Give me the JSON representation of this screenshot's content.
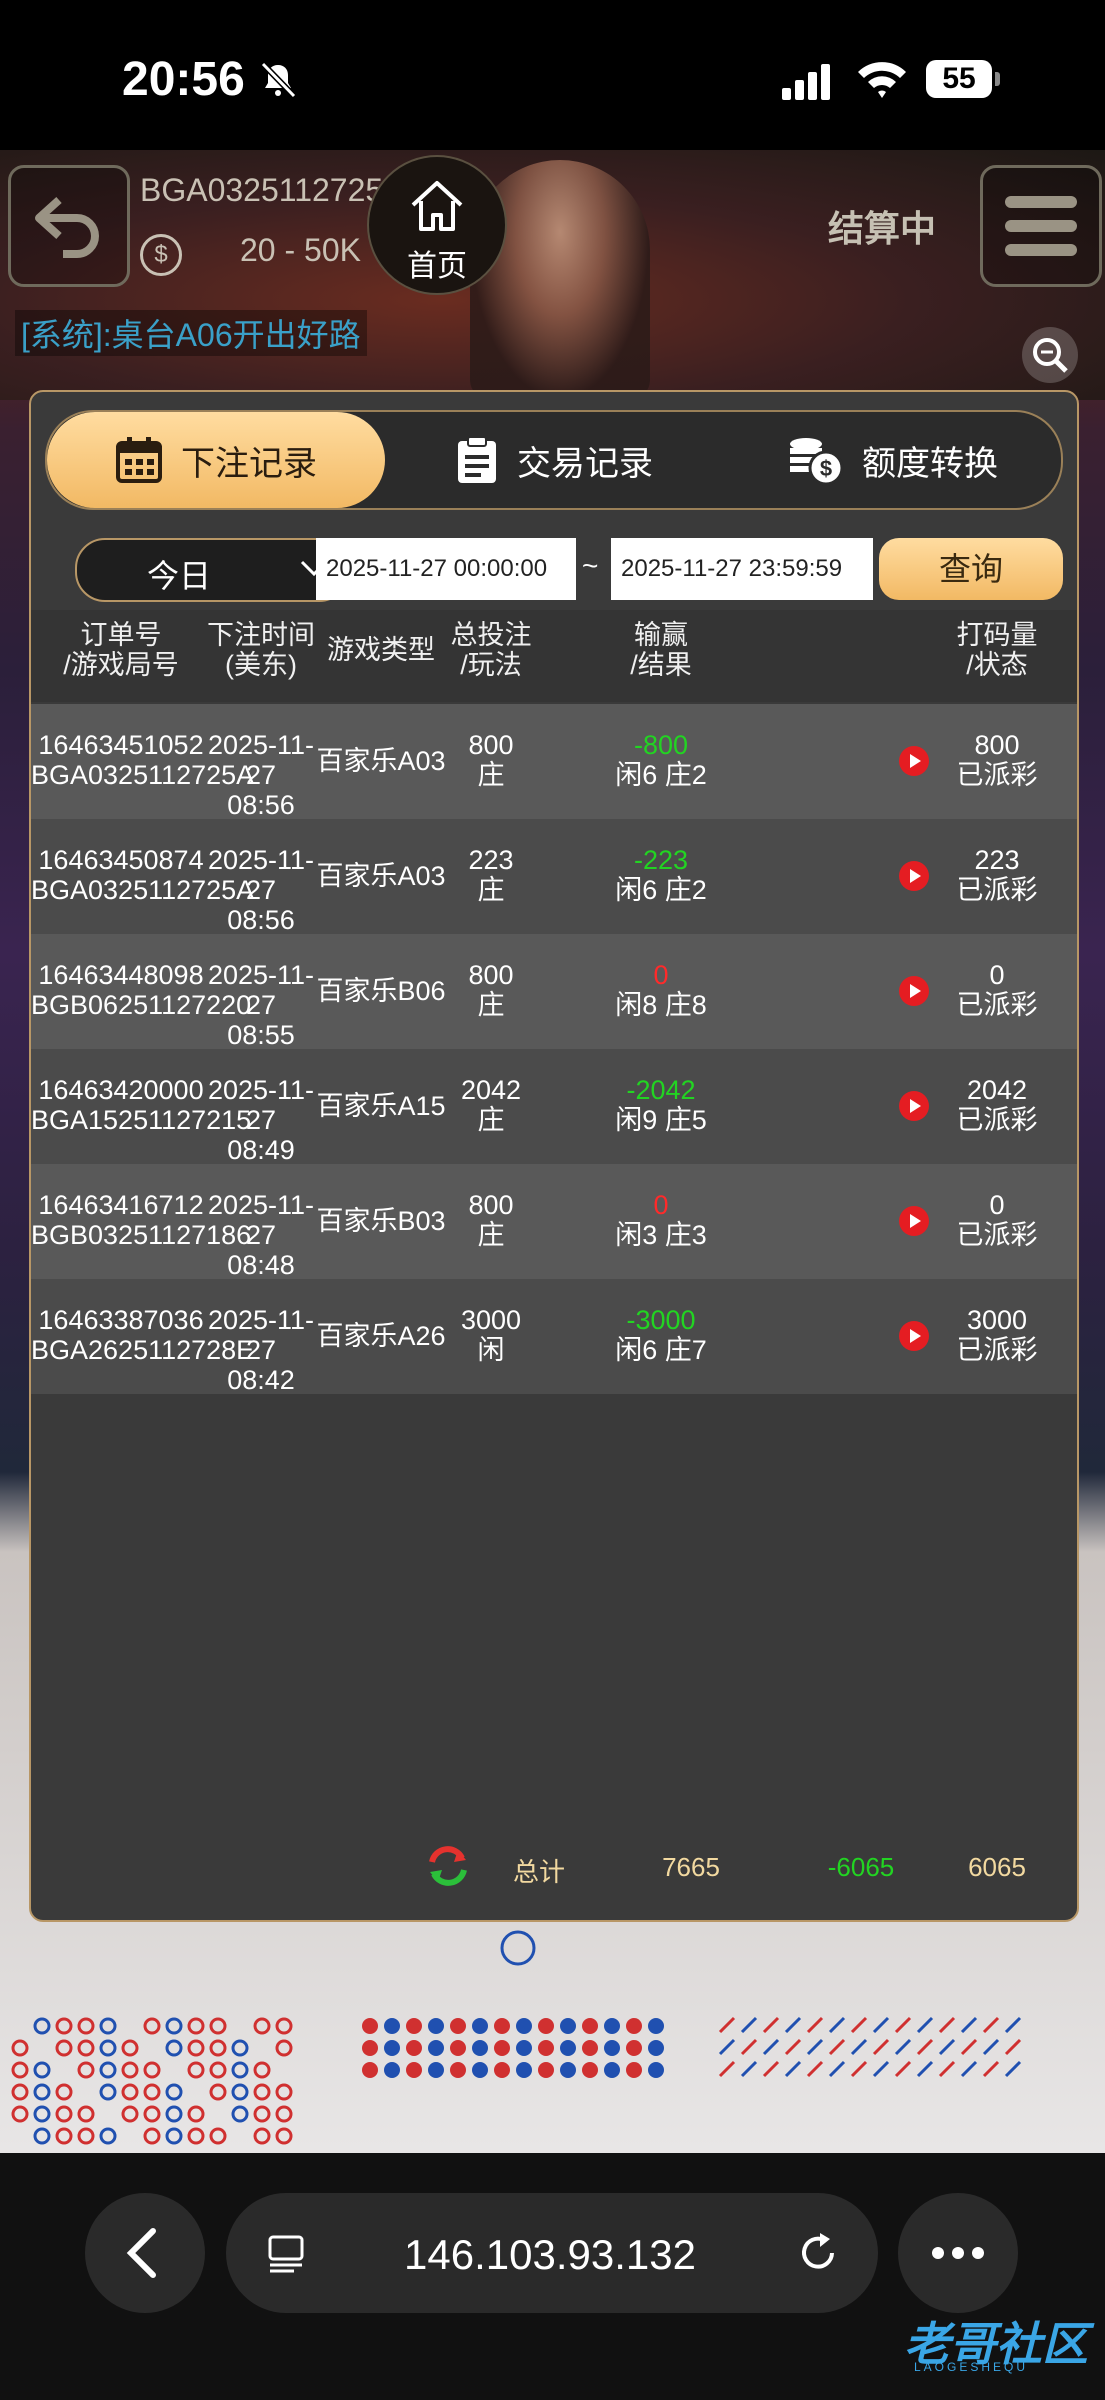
{
  "status_bar": {
    "time": "20:56",
    "battery": "55"
  },
  "game": {
    "table_id": "BGA0325112725A",
    "limit": "20 - 50K",
    "home_label": "首页",
    "status": "结算中",
    "system_message": "[系统]:桌台A06开出好路"
  },
  "tabs": [
    {
      "label": "下注记录",
      "icon": "calendar-icon",
      "active": true
    },
    {
      "label": "交易记录",
      "icon": "clipboard-icon",
      "active": false
    },
    {
      "label": "额度转换",
      "icon": "coins-icon",
      "active": false
    }
  ],
  "filter": {
    "period": "今日",
    "start": "2025-11-27 00:00:00",
    "separator": "~",
    "end": "2025-11-27 23:59:59",
    "query_label": "查询"
  },
  "table": {
    "headers": [
      {
        "line1": "订单号",
        "line2": "/游戏局号"
      },
      {
        "line1": "下注时间",
        "line2": "(美东)"
      },
      {
        "line1": "游戏类型",
        "line2": ""
      },
      {
        "line1": "总投注",
        "line2": "/玩法"
      },
      {
        "line1": "输赢",
        "line2": "/结果"
      },
      {
        "line1": "打码量",
        "line2": "/状态"
      }
    ],
    "rows": [
      {
        "order": "16463451052",
        "round": "BGA0325112725A",
        "date": "2025-11-27",
        "time": "08:56",
        "game": "百家乐A03",
        "bet": "800",
        "play": "庄",
        "winloss": "-800",
        "result": "闲6 庄2",
        "turnover": "800",
        "status": "已派彩"
      },
      {
        "order": "16463450874",
        "round": "BGA0325112725A",
        "date": "2025-11-27",
        "time": "08:56",
        "game": "百家乐A03",
        "bet": "223",
        "play": "庄",
        "winloss": "-223",
        "result": "闲6 庄2",
        "turnover": "223",
        "status": "已派彩"
      },
      {
        "order": "16463448098",
        "round": "BGB06251127220",
        "date": "2025-11-27",
        "time": "08:55",
        "game": "百家乐B06",
        "bet": "800",
        "play": "庄",
        "winloss": "0",
        "result": "闲8 庄8",
        "turnover": "0",
        "status": "已派彩"
      },
      {
        "order": "16463420000",
        "round": "BGA15251127215",
        "date": "2025-11-27",
        "time": "08:49",
        "game": "百家乐A15",
        "bet": "2042",
        "play": "庄",
        "winloss": "-2042",
        "result": "闲9 庄5",
        "turnover": "2042",
        "status": "已派彩"
      },
      {
        "order": "16463416712",
        "round": "BGB03251127186",
        "date": "2025-11-27",
        "time": "08:48",
        "game": "百家乐B03",
        "bet": "800",
        "play": "庄",
        "winloss": "0",
        "result": "闲3 庄3",
        "turnover": "0",
        "status": "已派彩"
      },
      {
        "order": "16463387036",
        "round": "BGA2625112728E",
        "date": "2025-11-27",
        "time": "08:42",
        "game": "百家乐A26",
        "bet": "3000",
        "play": "闲",
        "winloss": "-3000",
        "result": "闲6 庄7",
        "turnover": "3000",
        "status": "已派彩"
      }
    ]
  },
  "totals": {
    "label": "总计",
    "bet": "7665",
    "winloss": "-6065",
    "turnover": "6065"
  },
  "browser": {
    "url": "146.103.93.132"
  },
  "watermark": {
    "text": "老哥社区",
    "sub": "LAOGESHEQU"
  },
  "colors": {
    "accent": "#f2b964",
    "loss": "#22d422",
    "zero": "#ff2a2a",
    "play": "#e51d22"
  }
}
